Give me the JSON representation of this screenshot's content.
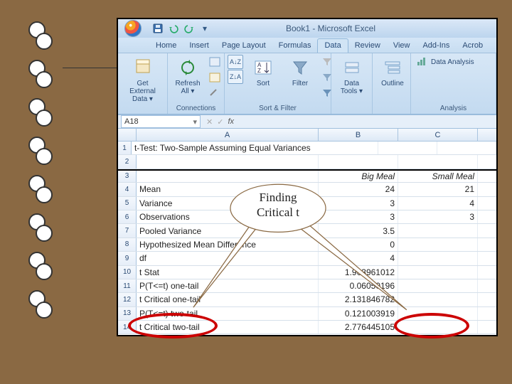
{
  "title": "Book1  -  Microsoft Excel",
  "qat": {
    "save": "Save",
    "undo": "Undo",
    "redo": "Redo"
  },
  "tabs": [
    "Home",
    "Insert",
    "Page Layout",
    "Formulas",
    "Data",
    "Review",
    "View",
    "Add-Ins",
    "Acrob"
  ],
  "active_tab": "Data",
  "ribbon": {
    "get_external_data": "Get External Data ▾",
    "refresh_all": "Refresh All ▾",
    "connections_label": "Connections",
    "sort": "Sort",
    "filter": "Filter",
    "sort_filter_label": "Sort & Filter",
    "data_tools": "Data Tools ▾",
    "outline": "Outline",
    "data_analysis": "Data Analysis",
    "analysis_label": "Analysis"
  },
  "namebox": "A18",
  "columns": [
    "A",
    "B",
    "C"
  ],
  "sheet_rows": [
    {
      "n": 1,
      "a": "t-Test: Two-Sample Assuming Equal Variances",
      "b": "",
      "c": "",
      "title": true
    },
    {
      "n": 2,
      "a": "",
      "b": "",
      "c": ""
    },
    {
      "n": 3,
      "a": "",
      "b": "Big Meal",
      "c": "Small Meal",
      "header": true,
      "border_top": true
    },
    {
      "n": 4,
      "a": "Mean",
      "b": "24",
      "c": "21"
    },
    {
      "n": 5,
      "a": "Variance",
      "b": "3",
      "c": "4"
    },
    {
      "n": 6,
      "a": "Observations",
      "b": "3",
      "c": "3"
    },
    {
      "n": 7,
      "a": "Pooled Variance",
      "b": "3.5",
      "c": ""
    },
    {
      "n": 8,
      "a": "Hypothesized Mean Difference",
      "b": "0",
      "c": ""
    },
    {
      "n": 9,
      "a": "df",
      "b": "4",
      "c": ""
    },
    {
      "n": 10,
      "a": "t Stat",
      "b": "1.963961012",
      "c": ""
    },
    {
      "n": 11,
      "a": "P(T<=t) one-tail",
      "b": "0.06050196",
      "c": ""
    },
    {
      "n": 12,
      "a": "t Critical one-tail",
      "b": "2.131846782",
      "c": ""
    },
    {
      "n": 13,
      "a": "P(T<=t) two-tail",
      "b": "0.121003919",
      "c": ""
    },
    {
      "n": 14,
      "a": "t Critical two-tail",
      "b": "2.776445105",
      "c": ""
    }
  ],
  "callout_text": "Finding Critical t"
}
